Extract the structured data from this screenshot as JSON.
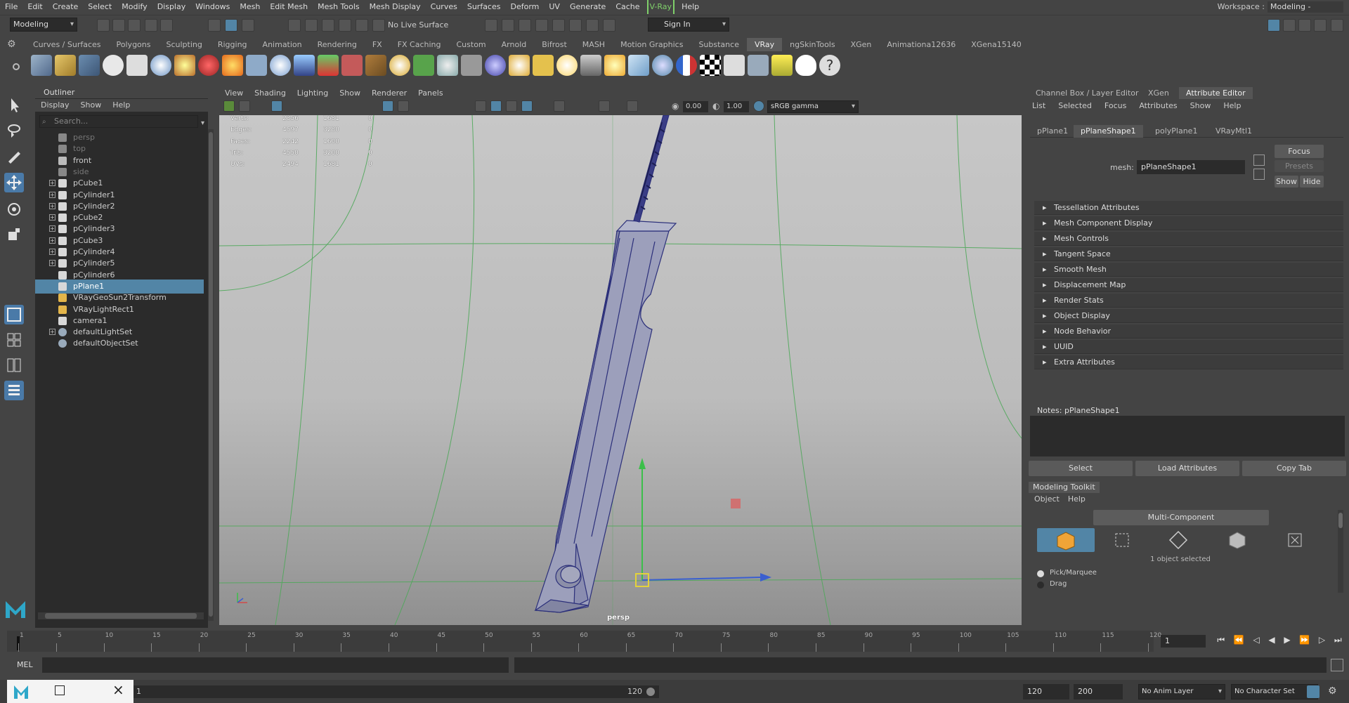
{
  "menubar": {
    "items": [
      "File",
      "Edit",
      "Create",
      "Select",
      "Modify",
      "Display",
      "Windows",
      "Mesh",
      "Edit Mesh",
      "Mesh Tools",
      "Mesh Display",
      "Curves",
      "Surfaces",
      "Deform",
      "UV",
      "Generate",
      "Cache",
      "V-Ray",
      "Help"
    ],
    "workspace_label": "Workspace :",
    "workspace_value": "Modeling - Standard"
  },
  "statusline": {
    "mode": "Modeling",
    "live_surface": "No Live Surface",
    "sign_in": "Sign In"
  },
  "shelf": {
    "tabs": [
      "Curves / Surfaces",
      "Polygons",
      "Sculpting",
      "Rigging",
      "Animation",
      "Rendering",
      "FX",
      "FX Caching",
      "Custom",
      "Arnold",
      "Bifrost",
      "MASH",
      "Motion Graphics",
      "Substance",
      "VRay",
      "ngSkinTools",
      "XGen",
      "Animationa12636",
      "XGena15140"
    ],
    "active_tab": "VRay"
  },
  "outliner": {
    "title": "Outliner",
    "menu": [
      "Display",
      "Show",
      "Help"
    ],
    "search_placeholder": "Search...",
    "items": [
      {
        "label": "persp",
        "dim": true,
        "expand": false
      },
      {
        "label": "top",
        "dim": true,
        "expand": false
      },
      {
        "label": "front",
        "dim": false,
        "expand": false
      },
      {
        "label": "side",
        "dim": true,
        "expand": false
      },
      {
        "label": "pCube1",
        "dim": false,
        "expand": true
      },
      {
        "label": "pCylinder1",
        "dim": false,
        "expand": true
      },
      {
        "label": "pCylinder2",
        "dim": false,
        "expand": true
      },
      {
        "label": "pCube2",
        "dim": false,
        "expand": true
      },
      {
        "label": "pCylinder3",
        "dim": false,
        "expand": true
      },
      {
        "label": "pCube3",
        "dim": false,
        "expand": true
      },
      {
        "label": "pCylinder4",
        "dim": false,
        "expand": true
      },
      {
        "label": "pCylinder5",
        "dim": false,
        "expand": true
      },
      {
        "label": "pCylinder6",
        "dim": false,
        "expand": false
      },
      {
        "label": "pPlane1",
        "dim": false,
        "expand": false,
        "selected": true
      },
      {
        "label": "VRayGeoSun2Transform",
        "dim": false,
        "expand": false
      },
      {
        "label": "VRayLightRect1",
        "dim": false,
        "expand": false
      },
      {
        "label": "camera1",
        "dim": false,
        "expand": false
      },
      {
        "label": "defaultLightSet",
        "dim": false,
        "expand": true
      },
      {
        "label": "defaultObjectSet",
        "dim": false,
        "expand": false
      }
    ]
  },
  "viewport": {
    "menu": [
      "View",
      "Shading",
      "Lighting",
      "Show",
      "Renderer",
      "Panels"
    ],
    "exposure": "0.00",
    "gamma": "1.00",
    "colorspace": "sRGB gamma",
    "camera_label": "persp",
    "hud": {
      "rows": [
        {
          "label": "Verts:",
          "a": "2356",
          "b": "1681",
          "c": "0"
        },
        {
          "label": "Edges:",
          "a": "4597",
          "b": "3280",
          "c": "0"
        },
        {
          "label": "Faces:",
          "a": "2242",
          "b": "1600",
          "c": "0"
        },
        {
          "label": "Tris:",
          "a": "4550",
          "b": "3200",
          "c": "0"
        },
        {
          "label": "UVs:",
          "a": "2494",
          "b": "1681",
          "c": "0"
        }
      ]
    }
  },
  "attribute_editor": {
    "panel_tabs": [
      "Channel Box / Layer Editor",
      "XGen",
      "Attribute Editor"
    ],
    "menu": [
      "List",
      "Selected",
      "Focus",
      "Attributes",
      "Show",
      "Help"
    ],
    "node_tabs": [
      "pPlane1",
      "pPlaneShape1",
      "polyPlane1",
      "VRayMtl1"
    ],
    "active_node_tab": "pPlaneShape1",
    "mesh_label": "mesh:",
    "mesh_value": "pPlaneShape1",
    "focus": "Focus",
    "presets": "Presets",
    "show": "Show",
    "hide": "Hide",
    "sections": [
      "Tessellation Attributes",
      "Mesh Component Display",
      "Mesh Controls",
      "Tangent Space",
      "Smooth Mesh",
      "Displacement Map",
      "Render Stats",
      "Object Display",
      "Node Behavior",
      "UUID",
      "Extra Attributes"
    ],
    "notes_label": "Notes:  pPlaneShape1",
    "select_btn": "Select",
    "load_btn": "Load Attributes",
    "copy_btn": "Copy Tab"
  },
  "modeling_toolkit": {
    "title": "Modeling Toolkit",
    "menu": [
      "Object",
      "Help"
    ],
    "multi_component": "Multi-Component",
    "selected_count": "1 object selected",
    "pick_marquee": "Pick/Marquee",
    "drag": "Drag"
  },
  "timeline": {
    "ticks": [
      "1",
      "5",
      "10",
      "15",
      "20",
      "25",
      "30",
      "35",
      "40",
      "45",
      "50",
      "55",
      "60",
      "65",
      "70",
      "75",
      "80",
      "85",
      "90",
      "95",
      "100",
      "105",
      "110",
      "115",
      "120"
    ],
    "current_frame": "1"
  },
  "cmdline": {
    "label": "MEL"
  },
  "bottombar": {
    "range_start": "1",
    "range_end_slider": "120",
    "end_a": "120",
    "end_b": "200",
    "anim_layer": "No Anim Layer",
    "char_set": "No Character Set"
  }
}
